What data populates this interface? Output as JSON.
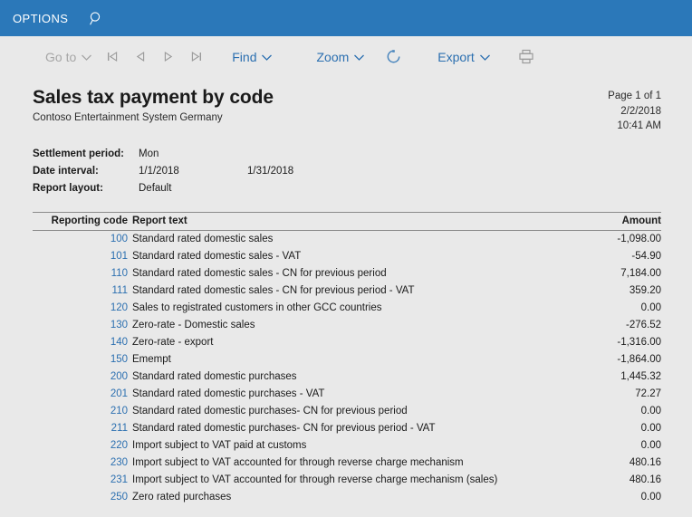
{
  "topbar": {
    "options_label": "OPTIONS",
    "search_icon": "search-icon",
    "background_color": "#2b78b9"
  },
  "toolbar": {
    "goto_label": "Go to",
    "first_page_icon": "first-page-icon",
    "previous_page_icon": "previous-page-icon",
    "next_page_icon": "next-page-icon",
    "last_page_icon": "last-page-icon",
    "find_label": "Find",
    "zoom_label": "Zoom",
    "refresh_icon": "refresh-icon",
    "export_label": "Export",
    "print_icon": "print-icon",
    "link_color": "#2b6fb0",
    "disabled_color": "#a6a6a6"
  },
  "report": {
    "title": "Sales tax payment by code",
    "company": "Contoso Entertainment System Germany",
    "page_info": "Page 1 of 1",
    "date": "2/2/2018",
    "time": "10:41 AM",
    "parameters": [
      {
        "label": "Settlement period:",
        "value": "Mon",
        "value2": ""
      },
      {
        "label": "Date interval:",
        "value": "1/1/2018",
        "value2": "1/31/2018"
      },
      {
        "label": "Report layout:",
        "value": "Default",
        "value2": ""
      }
    ],
    "table": {
      "columns": [
        "Reporting code",
        "Report text",
        "Amount"
      ],
      "rows": [
        {
          "code": "100",
          "text": "Standard rated domestic sales",
          "amount": "-1,098.00"
        },
        {
          "code": "101",
          "text": "Standard rated domestic sales - VAT",
          "amount": "-54.90"
        },
        {
          "code": "110",
          "text": "Standard rated domestic sales - CN for previous period",
          "amount": "7,184.00"
        },
        {
          "code": "111",
          "text": "Standard rated domestic sales - CN for previous period - VAT",
          "amount": "359.20"
        },
        {
          "code": "120",
          "text": "Sales to registrated customers in other GCC countries",
          "amount": "0.00"
        },
        {
          "code": "130",
          "text": "Zero-rate - Domestic sales",
          "amount": "-276.52"
        },
        {
          "code": "140",
          "text": "Zero-rate - export",
          "amount": "-1,316.00"
        },
        {
          "code": "150",
          "text": "Ememp­t",
          "amount": "-1,864.00"
        },
        {
          "code": "200",
          "text": "Standard rated domestic purchases",
          "amount": "1,445.32"
        },
        {
          "code": "201",
          "text": "Standard rated domestic purchases - VAT",
          "amount": "72.27"
        },
        {
          "code": "210",
          "text": "Standard rated domestic purchases-  CN for previous period",
          "amount": "0.00"
        },
        {
          "code": "211",
          "text": "Standard rated domestic purchases-  CN for previous period - VAT",
          "amount": "0.00"
        },
        {
          "code": "220",
          "text": "Import subject to VAT paid at customs",
          "amount": "0.00"
        },
        {
          "code": "230",
          "text": "Import subject to VAT accounted for through reverse charge mechanism",
          "amount": "480.16"
        },
        {
          "code": "231",
          "text": "Import subject to VAT accounted for through reverse charge mechanism (sales)",
          "amount": "480.16"
        },
        {
          "code": "250",
          "text": "Zero rated purchases",
          "amount": "0.00"
        }
      ]
    }
  }
}
